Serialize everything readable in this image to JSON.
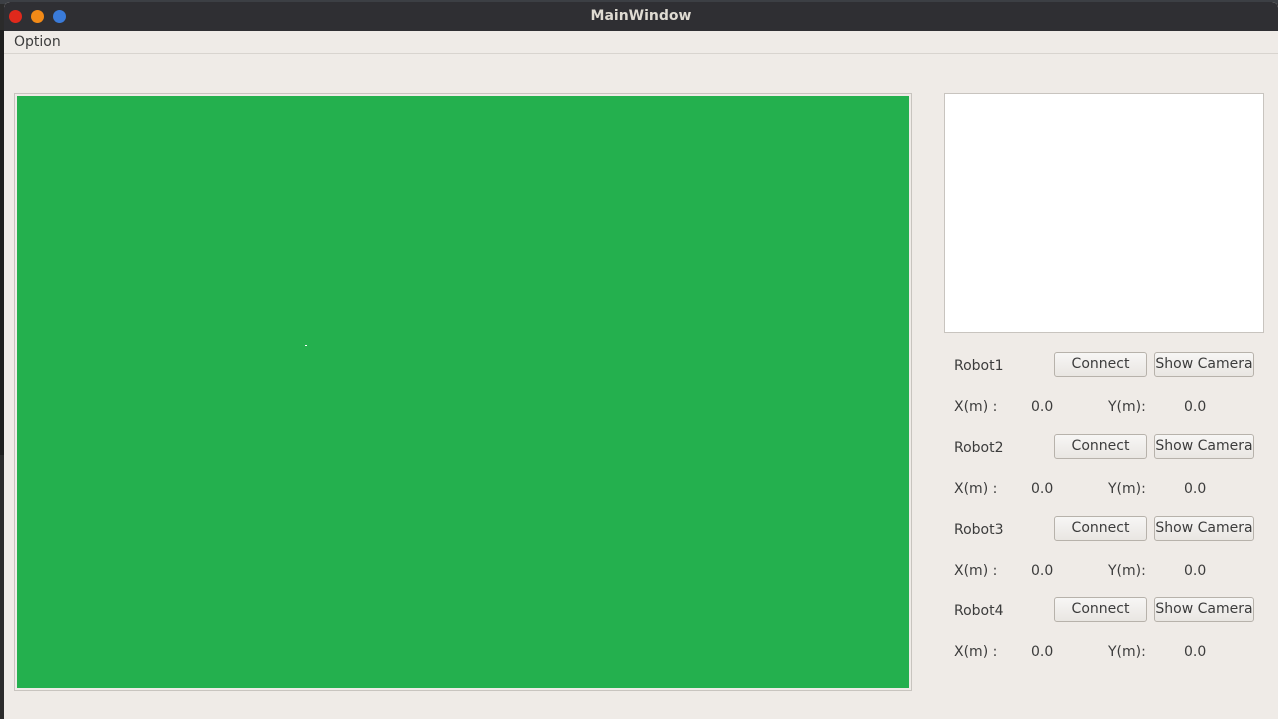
{
  "window": {
    "title": "MainWindow"
  },
  "menu": {
    "items": [
      "Option"
    ]
  },
  "field": {
    "background_color": "#24b04e"
  },
  "robots": [
    {
      "name": "Robot1",
      "connect_label": "Connect",
      "camera_label": "Show Camera",
      "x_label": "X(m) :",
      "x_value": "0.0",
      "y_label": "Y(m):",
      "y_value": "0.0"
    },
    {
      "name": "Robot2",
      "connect_label": "Connect",
      "camera_label": "Show Camera",
      "x_label": "X(m) :",
      "x_value": "0.0",
      "y_label": "Y(m):",
      "y_value": "0.0"
    },
    {
      "name": "Robot3",
      "connect_label": "Connect",
      "camera_label": "Show Camera",
      "x_label": "X(m) :",
      "x_value": "0.0",
      "y_label": "Y(m):",
      "y_value": "0.0"
    },
    {
      "name": "Robot4",
      "connect_label": "Connect",
      "camera_label": "Show Camera",
      "x_label": "X(m) :",
      "x_value": "0.0",
      "y_label": "Y(m):",
      "y_value": "0.0"
    }
  ],
  "colors": {
    "titlebar": "#2f2f33",
    "close": "#e0291c",
    "minimize": "#f28a17",
    "maximize": "#3a7bd9",
    "window_bg": "#efebe7"
  }
}
